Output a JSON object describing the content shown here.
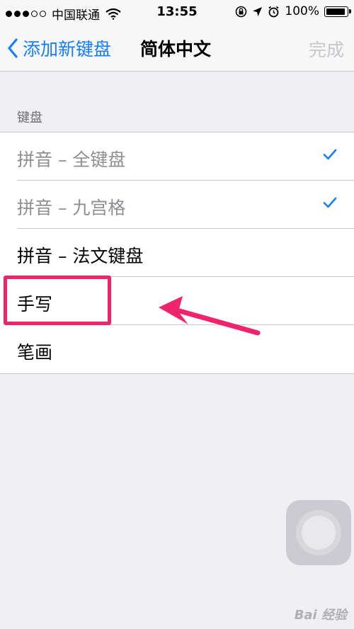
{
  "status_bar": {
    "carrier": "中国联通",
    "time": "13:55",
    "battery": "100%",
    "signal_strength": 3
  },
  "nav": {
    "back_label": "添加新键盘",
    "title": "简体中文",
    "done_label": "完成"
  },
  "section": {
    "header": "键盘",
    "items": [
      {
        "label": "拼音 – 全键盘",
        "checked": true
      },
      {
        "label": "拼音 – 九宫格",
        "checked": true
      },
      {
        "label": "拼音 – 法文键盘",
        "checked": false
      },
      {
        "label": "手写",
        "checked": false
      },
      {
        "label": "笔画",
        "checked": false
      }
    ]
  },
  "colors": {
    "accent": "#147efb",
    "annotation": "#f0246c"
  },
  "watermark": "Bai 经验"
}
